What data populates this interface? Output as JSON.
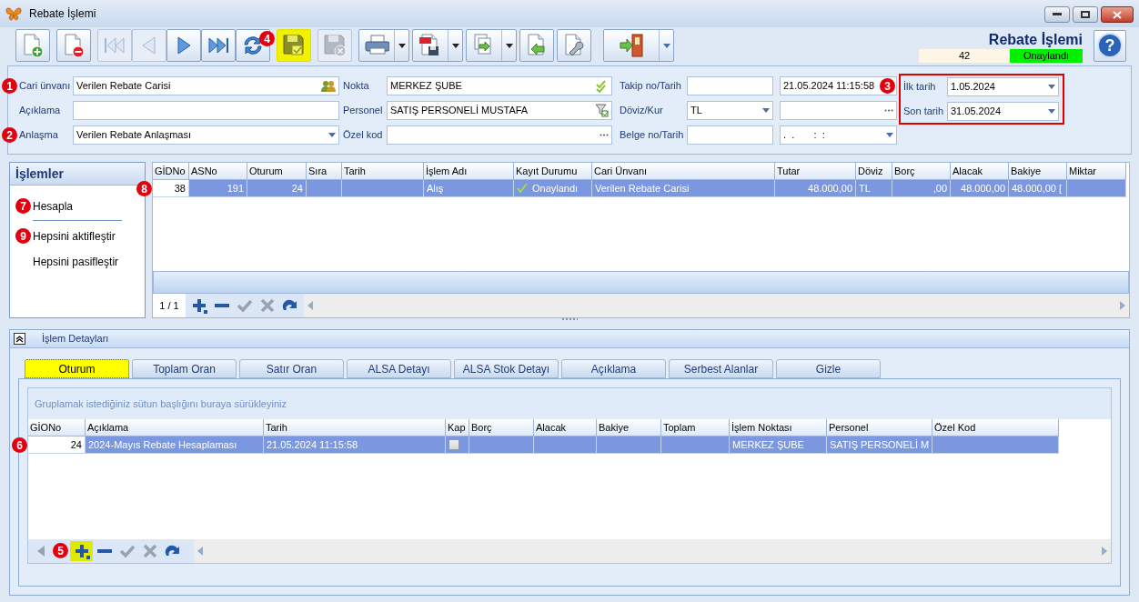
{
  "window": {
    "title": "Rebate İşlemi"
  },
  "toolbar": {
    "groups": [
      [
        {
          "kind": "new",
          "disabled": false,
          "highlighted": false,
          "dropdown": false
        }
      ],
      [
        {
          "kind": "delete",
          "disabled": false,
          "highlighted": false,
          "dropdown": false
        }
      ],
      [
        {
          "kind": "first",
          "disabled": true,
          "highlighted": false,
          "dropdown": false
        },
        {
          "kind": "previous",
          "disabled": true,
          "highlighted": false,
          "dropdown": false
        },
        {
          "kind": "next",
          "disabled": false,
          "highlighted": false,
          "dropdown": false
        },
        {
          "kind": "last",
          "disabled": false,
          "highlighted": false,
          "dropdown": false
        },
        {
          "kind": "refresh",
          "disabled": false,
          "highlighted": false,
          "dropdown": false,
          "callout": "4"
        }
      ],
      [
        {
          "kind": "save",
          "disabled": false,
          "highlighted": true,
          "dropdown": false
        }
      ],
      [
        {
          "kind": "discard",
          "disabled": true,
          "highlighted": false,
          "dropdown": false
        }
      ],
      [
        {
          "kind": "print",
          "disabled": false,
          "highlighted": false,
          "dropdown": true
        },
        {
          "kind": "pdf",
          "disabled": false,
          "highlighted": false,
          "dropdown": true
        },
        {
          "kind": "export",
          "disabled": false,
          "highlighted": false,
          "dropdown": true
        },
        {
          "kind": "import",
          "disabled": false,
          "highlighted": false,
          "dropdown": false
        },
        {
          "kind": "tools",
          "disabled": false,
          "highlighted": false,
          "dropdown": false
        }
      ],
      [
        {
          "kind": "exit",
          "disabled": false,
          "highlighted": false,
          "dropdown": true
        }
      ]
    ],
    "heading": "Rebate İşlemi",
    "record_no": "42",
    "status": "Onaylandı",
    "help": "?"
  },
  "form": {
    "rows": [
      [
        {
          "label": "Cari ünvanı",
          "callout": "1",
          "inputs": [
            {
              "kind": "lookup",
              "value": "Verilen Rebate Carisi"
            }
          ]
        },
        {
          "label": "Nokta",
          "inputs": [
            {
              "kind": "check",
              "value": "MERKEZ ŞUBE"
            }
          ]
        },
        {
          "label": "Takip no/Tarih",
          "inputs": [
            {
              "kind": "text"
            },
            {
              "kind": "text",
              "value": "21.05.2024 11:15:58",
              "callout": "3"
            }
          ]
        }
      ],
      [
        {
          "label": "Açıklama",
          "inputs": [
            {
              "kind": "text"
            }
          ]
        },
        {
          "label": "Personel",
          "inputs": [
            {
              "kind": "filter",
              "value": "SATIŞ PERSONELİ MUSTAFA"
            }
          ]
        },
        {
          "label": "Döviz/Kur",
          "inputs": [
            {
              "kind": "combo",
              "value": "TL"
            },
            {
              "kind": "ellipsis"
            }
          ]
        }
      ],
      [
        {
          "label": "Anlaşma",
          "callout": "2",
          "inputs": [
            {
              "kind": "combo",
              "value": "Verilen Rebate Anlaşması"
            }
          ]
        },
        {
          "label": "Özel kod",
          "inputs": [
            {
              "kind": "ellipsis"
            }
          ]
        },
        {
          "label": "Belge no/Tarih",
          "inputs": [
            {
              "kind": "text"
            },
            {
              "kind": "combo",
              "value": ".  .       :  :"
            }
          ]
        }
      ]
    ],
    "date_range": [
      {
        "label": "İlk tarih",
        "value": "1.05.2024"
      },
      {
        "label": "Son tarih",
        "value": "31.05.2024"
      }
    ]
  },
  "sidebar": {
    "title": "İşlemler",
    "items": [
      {
        "label": "Hesapla",
        "callout": "7",
        "separator_after": true
      },
      {
        "label": "Hepsini aktifleştir",
        "callout": "9",
        "separator_after": false
      },
      {
        "label": "Hepsini pasifleştir",
        "separator_after": false
      }
    ]
  },
  "transactions": {
    "columns": [
      {
        "label": "GİDNo",
        "kind": "number",
        "frozen": true
      },
      {
        "label": "ASNo",
        "kind": "number",
        "frozen": false
      },
      {
        "label": "Oturum",
        "kind": "number",
        "frozen": false
      },
      {
        "label": "Sıra",
        "kind": "number",
        "frozen": false
      },
      {
        "label": "Tarih",
        "kind": "text",
        "frozen": false
      },
      {
        "label": "İşlem Adı",
        "kind": "text",
        "frozen": false
      },
      {
        "label": "Kayıt Durumu",
        "kind": "status",
        "frozen": false
      },
      {
        "label": "Cari Ünvanı",
        "kind": "text",
        "frozen": false
      },
      {
        "label": "Tutar",
        "kind": "number",
        "frozen": false
      },
      {
        "label": "Döviz",
        "kind": "text",
        "frozen": false
      },
      {
        "label": "Borç",
        "kind": "number",
        "frozen": false
      },
      {
        "label": "Alacak",
        "kind": "number",
        "frozen": false
      },
      {
        "label": "Bakiye",
        "kind": "text",
        "frozen": false
      },
      {
        "label": "Miktar",
        "kind": "text",
        "frozen": false
      }
    ],
    "rows": [
      {
        "selected": true,
        "callout": "8",
        "cells": [
          "38",
          "191",
          "24",
          "",
          "",
          "Alış",
          "Onaylandı",
          "Verilen Rebate Carisi",
          "48.000,00",
          "TL",
          ",00",
          "48.000,00",
          "48.000,00 [",
          ""
        ]
      }
    ],
    "pager": "1 / 1",
    "nav": [
      {
        "kind": "add",
        "disabled": false,
        "highlighted": false
      },
      {
        "kind": "remove",
        "disabled": false,
        "highlighted": false
      },
      {
        "kind": "confirm",
        "disabled": true,
        "highlighted": false
      },
      {
        "kind": "cancel",
        "disabled": true,
        "highlighted": false
      },
      {
        "kind": "redo",
        "disabled": false,
        "highlighted": false
      }
    ]
  },
  "details": {
    "title": "İşlem Detayları",
    "expanded": true,
    "tabs": [
      {
        "label": "Oturum",
        "selected": true
      },
      {
        "label": "Toplam Oran",
        "selected": false
      },
      {
        "label": "Satır Oran",
        "selected": false
      },
      {
        "label": "ALSA Detayı",
        "selected": false
      },
      {
        "label": "ALSA Stok Detayı",
        "selected": false
      },
      {
        "label": "Açıklama",
        "selected": false
      },
      {
        "label": "Serbest Alanlar",
        "selected": false
      },
      {
        "label": "Gizle",
        "selected": false
      }
    ],
    "group_hint": "Gruplamak istediğiniz sütun başlığını buraya sürükleyiniz",
    "columns": [
      {
        "label": "GİONo",
        "kind": "number",
        "frozen": true
      },
      {
        "label": "Açıklama",
        "kind": "text",
        "frozen": false
      },
      {
        "label": "Tarih",
        "kind": "text",
        "frozen": false
      },
      {
        "label": "Kap",
        "kind": "checkbox",
        "frozen": false
      },
      {
        "label": "Borç",
        "kind": "number",
        "frozen": false
      },
      {
        "label": "Alacak",
        "kind": "number",
        "frozen": false
      },
      {
        "label": "Bakiye",
        "kind": "number",
        "frozen": false
      },
      {
        "label": "Toplam",
        "kind": "number",
        "frozen": false
      },
      {
        "label": "İşlem Noktası",
        "kind": "text",
        "frozen": false
      },
      {
        "label": "Personel",
        "kind": "text",
        "frozen": false
      },
      {
        "label": "Özel Kod",
        "kind": "text",
        "frozen": false
      }
    ],
    "rows": [
      {
        "selected": true,
        "callout": "6",
        "cells": [
          "24",
          "2024-Mayıs Rebate Hesaplaması",
          "21.05.2024 11:15:58",
          {
            "checked": false
          },
          "",
          "",
          "",
          "",
          "MERKEZ ŞUBE",
          "SATIŞ PERSONELİ M",
          ""
        ]
      }
    ],
    "nav": [
      {
        "kind": "previous",
        "disabled": true,
        "highlighted": false
      },
      {
        "kind": "add",
        "disabled": false,
        "highlighted": true,
        "callout": "5"
      },
      {
        "kind": "remove",
        "disabled": false,
        "highlighted": false
      },
      {
        "kind": "confirm",
        "disabled": true,
        "highlighted": false
      },
      {
        "kind": "cancel",
        "disabled": true,
        "highlighted": false
      },
      {
        "kind": "redo",
        "disabled": false,
        "highlighted": false
      }
    ]
  }
}
